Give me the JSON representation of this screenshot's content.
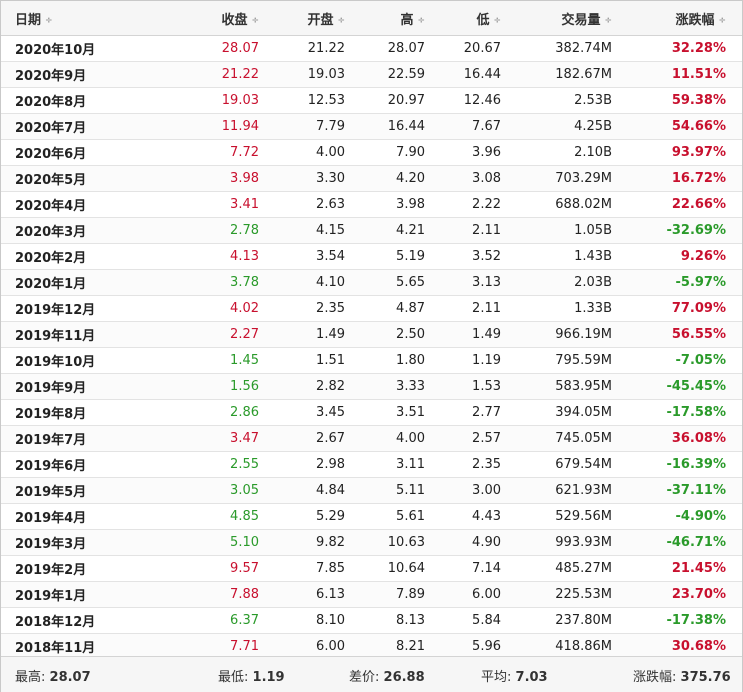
{
  "headers": {
    "date": "日期",
    "close": "收盘",
    "open": "开盘",
    "high": "高",
    "low": "低",
    "volume": "交易量",
    "change": "涨跌幅",
    "sort_glyph": "÷"
  },
  "rows": [
    {
      "date": "2020年10月",
      "close": "28.07",
      "open": "21.22",
      "high": "28.07",
      "low": "20.67",
      "volume": "382.74M",
      "change": "32.28%",
      "dir": "up"
    },
    {
      "date": "2020年9月",
      "close": "21.22",
      "open": "19.03",
      "high": "22.59",
      "low": "16.44",
      "volume": "182.67M",
      "change": "11.51%",
      "dir": "up"
    },
    {
      "date": "2020年8月",
      "close": "19.03",
      "open": "12.53",
      "high": "20.97",
      "low": "12.46",
      "volume": "2.53B",
      "change": "59.38%",
      "dir": "up"
    },
    {
      "date": "2020年7月",
      "close": "11.94",
      "open": "7.79",
      "high": "16.44",
      "low": "7.67",
      "volume": "4.25B",
      "change": "54.66%",
      "dir": "up"
    },
    {
      "date": "2020年6月",
      "close": "7.72",
      "open": "4.00",
      "high": "7.90",
      "low": "3.96",
      "volume": "2.10B",
      "change": "93.97%",
      "dir": "up"
    },
    {
      "date": "2020年5月",
      "close": "3.98",
      "open": "3.30",
      "high": "4.20",
      "low": "3.08",
      "volume": "703.29M",
      "change": "16.72%",
      "dir": "up"
    },
    {
      "date": "2020年4月",
      "close": "3.41",
      "open": "2.63",
      "high": "3.98",
      "low": "2.22",
      "volume": "688.02M",
      "change": "22.66%",
      "dir": "up"
    },
    {
      "date": "2020年3月",
      "close": "2.78",
      "open": "4.15",
      "high": "4.21",
      "low": "2.11",
      "volume": "1.05B",
      "change": "-32.69%",
      "dir": "down"
    },
    {
      "date": "2020年2月",
      "close": "4.13",
      "open": "3.54",
      "high": "5.19",
      "low": "3.52",
      "volume": "1.43B",
      "change": "9.26%",
      "dir": "up"
    },
    {
      "date": "2020年1月",
      "close": "3.78",
      "open": "4.10",
      "high": "5.65",
      "low": "3.13",
      "volume": "2.03B",
      "change": "-5.97%",
      "dir": "down"
    },
    {
      "date": "2019年12月",
      "close": "4.02",
      "open": "2.35",
      "high": "4.87",
      "low": "2.11",
      "volume": "1.33B",
      "change": "77.09%",
      "dir": "up"
    },
    {
      "date": "2019年11月",
      "close": "2.27",
      "open": "1.49",
      "high": "2.50",
      "low": "1.49",
      "volume": "966.19M",
      "change": "56.55%",
      "dir": "up"
    },
    {
      "date": "2019年10月",
      "close": "1.45",
      "open": "1.51",
      "high": "1.80",
      "low": "1.19",
      "volume": "795.59M",
      "change": "-7.05%",
      "dir": "down"
    },
    {
      "date": "2019年9月",
      "close": "1.56",
      "open": "2.82",
      "high": "3.33",
      "low": "1.53",
      "volume": "583.95M",
      "change": "-45.45%",
      "dir": "down"
    },
    {
      "date": "2019年8月",
      "close": "2.86",
      "open": "3.45",
      "high": "3.51",
      "low": "2.77",
      "volume": "394.05M",
      "change": "-17.58%",
      "dir": "down"
    },
    {
      "date": "2019年7月",
      "close": "3.47",
      "open": "2.67",
      "high": "4.00",
      "low": "2.57",
      "volume": "745.05M",
      "change": "36.08%",
      "dir": "up"
    },
    {
      "date": "2019年6月",
      "close": "2.55",
      "open": "2.98",
      "high": "3.11",
      "low": "2.35",
      "volume": "679.54M",
      "change": "-16.39%",
      "dir": "down"
    },
    {
      "date": "2019年5月",
      "close": "3.05",
      "open": "4.84",
      "high": "5.11",
      "low": "3.00",
      "volume": "621.93M",
      "change": "-37.11%",
      "dir": "down"
    },
    {
      "date": "2019年4月",
      "close": "4.85",
      "open": "5.29",
      "high": "5.61",
      "low": "4.43",
      "volume": "529.56M",
      "change": "-4.90%",
      "dir": "down"
    },
    {
      "date": "2019年3月",
      "close": "5.10",
      "open": "9.82",
      "high": "10.63",
      "low": "4.90",
      "volume": "993.93M",
      "change": "-46.71%",
      "dir": "down"
    },
    {
      "date": "2019年2月",
      "close": "9.57",
      "open": "7.85",
      "high": "10.64",
      "low": "7.14",
      "volume": "485.27M",
      "change": "21.45%",
      "dir": "up"
    },
    {
      "date": "2019年1月",
      "close": "7.88",
      "open": "6.13",
      "high": "7.89",
      "low": "6.00",
      "volume": "225.53M",
      "change": "23.70%",
      "dir": "up"
    },
    {
      "date": "2018年12月",
      "close": "6.37",
      "open": "8.10",
      "high": "8.13",
      "low": "5.84",
      "volume": "237.80M",
      "change": "-17.38%",
      "dir": "down"
    },
    {
      "date": "2018年11月",
      "close": "7.71",
      "open": "6.00",
      "high": "8.21",
      "low": "5.96",
      "volume": "418.86M",
      "change": "30.68%",
      "dir": "up"
    }
  ],
  "footer": {
    "high_label": "最高:",
    "high_value": "28.07",
    "low_label": "最低:",
    "low_value": "1.19",
    "diff_label": "差价:",
    "diff_value": "26.88",
    "avg_label": "平均:",
    "avg_value": "7.03",
    "chg_label": "涨跌幅:",
    "chg_value": "375.76"
  },
  "colors": {
    "up": "#c8102e",
    "down": "#2a9a2a"
  }
}
